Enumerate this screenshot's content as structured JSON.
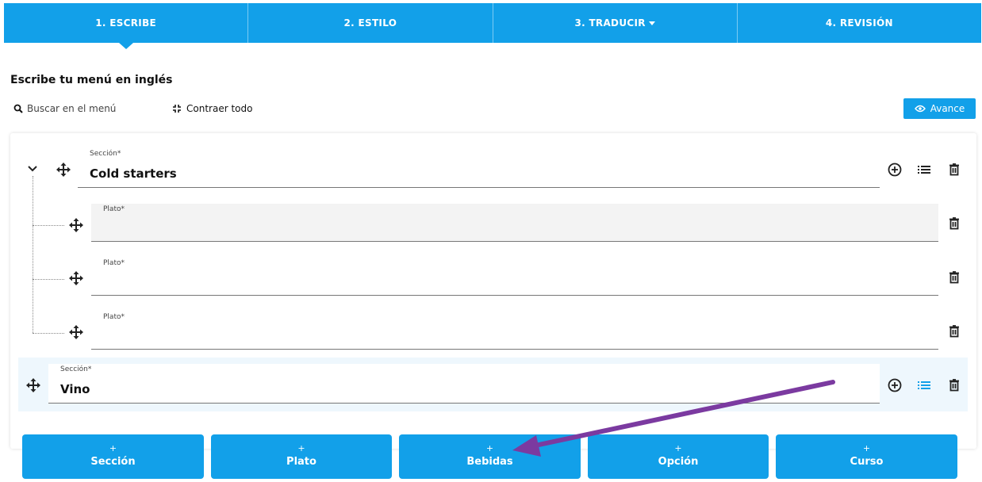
{
  "stepper": {
    "steps": [
      {
        "label": "1. ESCRIBE",
        "active": true
      },
      {
        "label": "2. ESTILO",
        "active": false
      },
      {
        "label": "3. TRADUCIR",
        "active": false,
        "has_dropdown": true
      },
      {
        "label": "4. REVISIÓN",
        "active": false
      }
    ]
  },
  "page_title": "Escribe tu menú en inglés",
  "toolbar": {
    "search_placeholder": "Buscar en el menú",
    "collapse_label": "Contraer todo",
    "preview_label": "Avance"
  },
  "menu": {
    "sections": [
      {
        "label": "Sección*",
        "value": "Cold starters",
        "expanded": true,
        "dishes": [
          {
            "label": "Plato*",
            "value": ""
          },
          {
            "label": "Plato*",
            "value": ""
          },
          {
            "label": "Plato*",
            "value": ""
          }
        ]
      },
      {
        "label": "Sección*",
        "value": "Vino",
        "highlighted": true,
        "dishes": []
      }
    ]
  },
  "add_buttons": [
    {
      "plus": "+",
      "label": "Sección"
    },
    {
      "plus": "+",
      "label": "Plato"
    },
    {
      "plus": "+",
      "label": "Bebidas"
    },
    {
      "plus": "+",
      "label": "Opción"
    },
    {
      "plus": "+",
      "label": "Curso"
    }
  ],
  "colors": {
    "accent": "#12a0e9",
    "annotation_arrow": "#7b3aa0",
    "highlight_row": "#eef7fd"
  },
  "icons": [
    "search-icon",
    "collapse-icon",
    "eye-icon",
    "chevron-down-icon",
    "drag-handle-icon",
    "add-circle-icon",
    "list-icon",
    "trash-icon"
  ]
}
